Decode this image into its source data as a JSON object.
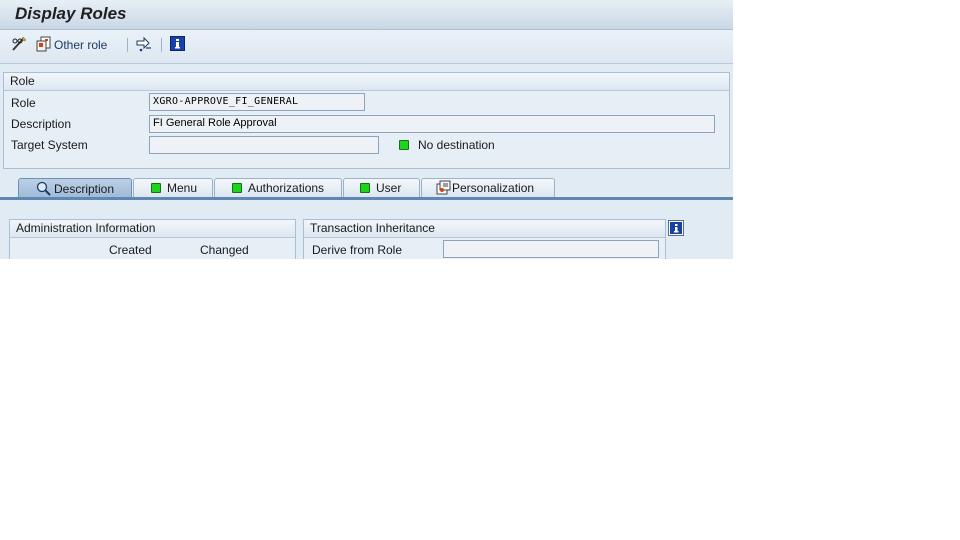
{
  "window": {
    "title": "Display Roles"
  },
  "toolbar": {
    "other_role_label": "Other role"
  },
  "role_group": {
    "header": "Role",
    "role_label": "Role",
    "role_value": "XGRO-APPROVE_FI_GENERAL",
    "description_label": "Description",
    "description_value": "FI General Role Approval",
    "target_label": "Target System",
    "target_value": "",
    "destination_status": "No destination",
    "status_color": "#1ed41e"
  },
  "tabs": [
    {
      "label": "Description",
      "icon": "magnifier-icon",
      "active": true
    },
    {
      "label": "Menu",
      "icon": "status-green-icon"
    },
    {
      "label": "Authorizations",
      "icon": "status-green-icon"
    },
    {
      "label": "User",
      "icon": "status-green-icon"
    },
    {
      "label": "Personalization",
      "icon": "personalization-icon"
    }
  ],
  "admin_info": {
    "header": "Administration Information",
    "col_created": "Created",
    "col_changed": "Changed"
  },
  "transaction_inheritance": {
    "header": "Transaction Inheritance",
    "derive_label": "Derive from Role",
    "derive_value": ""
  },
  "colors": {
    "accent": "#5f87b4",
    "background": "#e1ebf4"
  }
}
